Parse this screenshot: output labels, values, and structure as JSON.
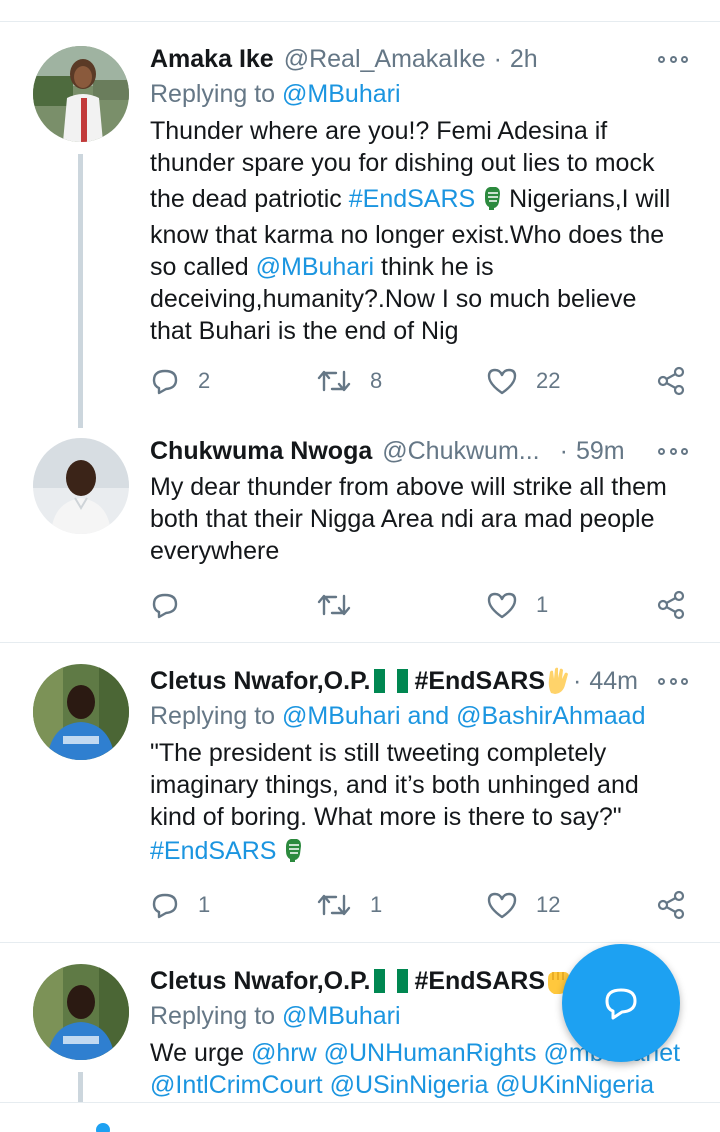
{
  "tweets": [
    {
      "name": "Amaka Ike",
      "handle": "@Real_AmakaIke",
      "dot": "·",
      "time": "2h",
      "reply_prefix": "Replying to",
      "reply_to": "@MBuhari",
      "lines": {
        "l1": "Thunder where are you!? Femi Adesina if",
        "l2": "thunder spare you for dishing out lies to mock",
        "l3a": "the dead patriotic ",
        "l3tag": "#EndSARS",
        "l3b": " Nigerians,I will",
        "l4": "know that karma no longer exist.Who does the",
        "l5a": "so called ",
        "l5tag": "@MBuhari",
        "l5b": " think he is",
        "l6": "deceiving,humanity?.Now I so much believe",
        "l7": "that Buhari is the end of Nig"
      },
      "replies": "2",
      "retweets": "8",
      "likes": "22"
    },
    {
      "name": "Chukwuma Nwoga",
      "handle": "@Chukwum...",
      "dot": "·",
      "time": "59m",
      "lines": {
        "l1": "My dear thunder from above will strike all them",
        "l2": "both that their Nigga Area ndi ara mad people",
        "l3": "everywhere"
      },
      "likes": "1"
    },
    {
      "name": "Cletus Nwafor,O.P.",
      "name_tag": "#EndSARS",
      "dot": "·",
      "time": "44m",
      "reply_prefix": "Replying to",
      "reply_to": "@MBuhari",
      "reply_and": " and ",
      "reply_to2": "@BashirAhmaad",
      "lines": {
        "l1": "\"The president is still tweeting completely",
        "l2": "imaginary things, and it’s both unhinged and",
        "l3": "kind of boring. What more is there to say?\"",
        "l4tag": "#EndSARS"
      },
      "replies": "1",
      "retweets": "1",
      "likes": "12"
    },
    {
      "name": "Cletus Nwafor,O.P.",
      "name_tag": "#EndSARS",
      "reply_prefix": "Replying to",
      "reply_to": "@MBuhari",
      "lines": {
        "l1a": "We urge ",
        "l1m1": "@hrw",
        "l1m2": "@UNHumanRights",
        "l1m3": "@mbuhariet",
        "l2m1": "@IntlCrimCourt",
        "l2m2": "@USinNigeria",
        "l2m3": "@UKinNigeria"
      }
    }
  ],
  "icons": {
    "reply": "reply-icon",
    "retweet": "retweet-icon",
    "like": "heart-icon",
    "share": "share-icon",
    "more": "more-icon",
    "compose": "compose-reply-icon"
  },
  "colors": {
    "link": "#1b95e0",
    "muted": "#657786",
    "fab": "#1da1f2",
    "nigeria_green": "#008751"
  }
}
